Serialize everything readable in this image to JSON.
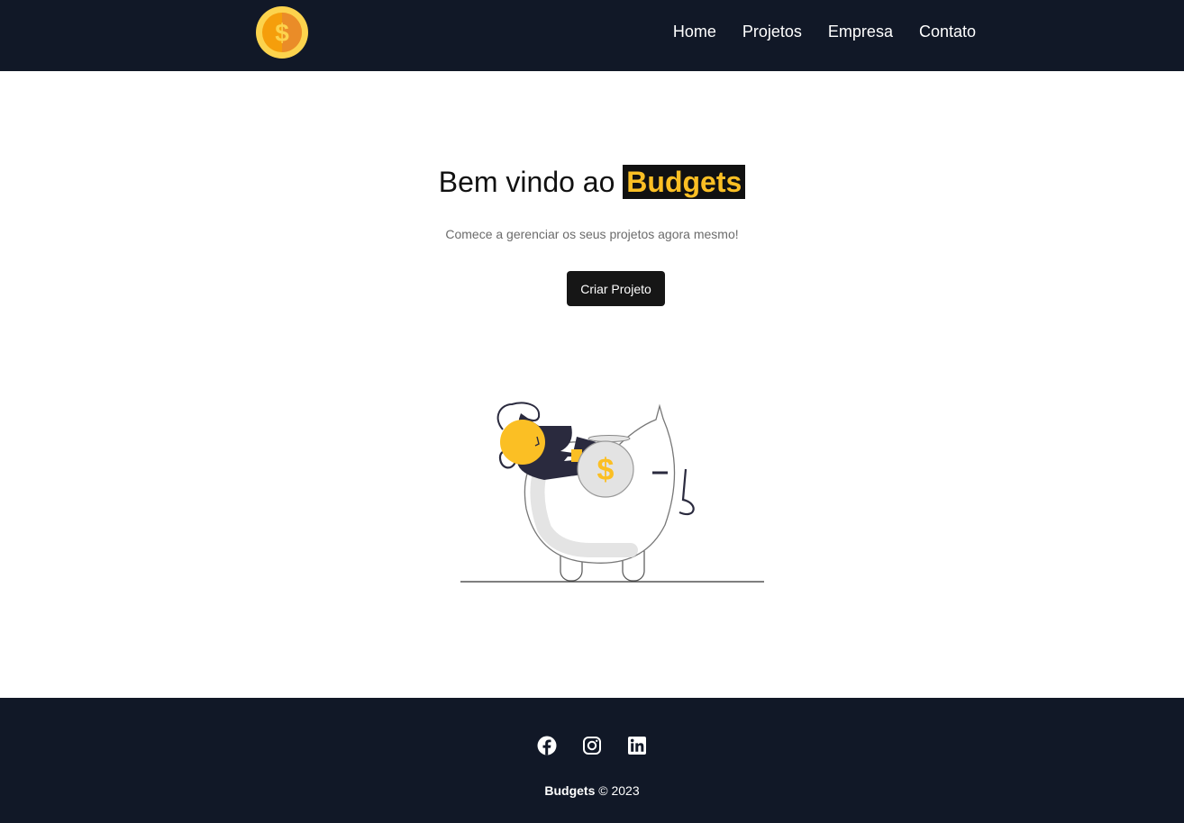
{
  "navbar": {
    "logo_icon": "dollar-coin-icon",
    "links": [
      "Home",
      "Projetos",
      "Empresa",
      "Contato"
    ]
  },
  "hero": {
    "title_prefix": "Bem vindo ao",
    "brand": "Budgets",
    "subtitle": "Comece a gerenciar os seus projetos agora mesmo!",
    "cta_label": "Criar Projeto",
    "illustration_icon": "piggy-bank-savings-illustration"
  },
  "footer": {
    "social_icons": [
      "facebook-icon",
      "instagram-icon",
      "linkedin-icon"
    ],
    "brand": "Budgets",
    "copyright": "© 2023"
  },
  "colors": {
    "dark_bg": "#111827",
    "accent": "#fbbf24",
    "button_bg": "#161616"
  }
}
